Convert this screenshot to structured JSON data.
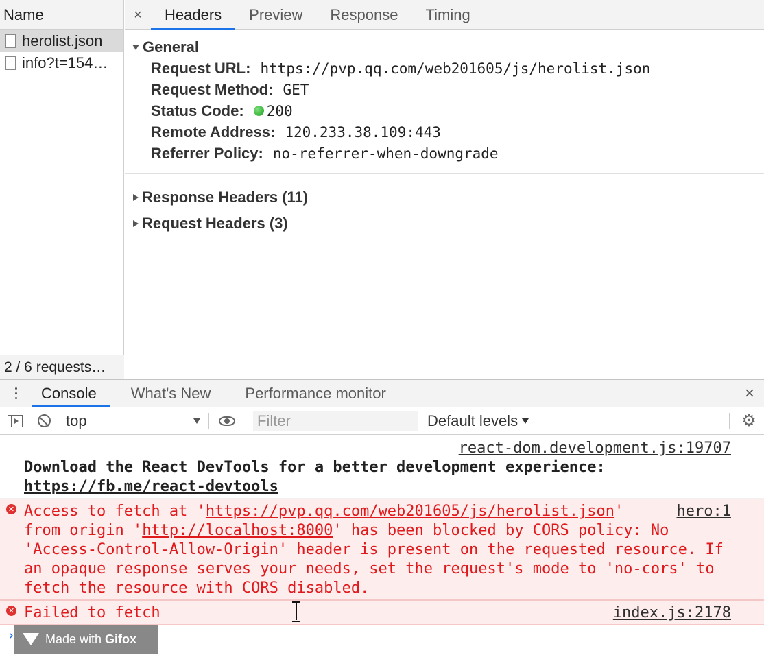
{
  "network": {
    "name_header": "Name",
    "requests": [
      {
        "label": "herolist.json",
        "selected": true
      },
      {
        "label": "info?t=154…",
        "selected": false
      }
    ],
    "summary": "2 / 6 requests…",
    "detail_tabs": [
      "Headers",
      "Preview",
      "Response",
      "Timing"
    ],
    "active_detail_tab": "Headers",
    "close_glyph": "×",
    "general": {
      "title": "General",
      "request_url_label": "Request URL:",
      "request_url": "https://pvp.qq.com/web201605/js/herolist.json",
      "request_method_label": "Request Method:",
      "request_method": "GET",
      "status_code_label": "Status Code:",
      "status_code": "200",
      "status_color": "#1a9e1a",
      "remote_address_label": "Remote Address:",
      "remote_address": "120.233.38.109:443",
      "referrer_policy_label": "Referrer Policy:",
      "referrer_policy": "no-referrer-when-downgrade"
    },
    "response_headers": "Response Headers (11)",
    "request_headers": "Request Headers (3)"
  },
  "drawer": {
    "tabs": [
      "Console",
      "What's New",
      "Performance monitor"
    ],
    "active_tab": "Console",
    "close_glyph": "×"
  },
  "console_toolbar": {
    "context": "top",
    "filter_placeholder": "Filter",
    "levels": "Default levels"
  },
  "console_messages": {
    "info": {
      "source": "react-dom.development.js:19707",
      "text": "Download the React DevTools for a better development experience: ",
      "link": "https://fb.me/react-devtools"
    },
    "cors_error": {
      "source": "hero:1",
      "part1": "Access to fetch at '",
      "url": "https://pvp.qq.com/web201605/js/herolist.json",
      "part2": "' from origin '",
      "origin": "http://localhost:8000",
      "part3": "' has been blocked by CORS policy: No 'Access-Control-Allow-Origin' header is present on the requested resource. If an opaque response serves your needs, set the request's mode to 'no-cors' to fetch the resource with CORS disabled."
    },
    "fetch_error": {
      "source": "index.js:2178",
      "text": "Failed to fetch"
    },
    "error_color": "#e0191c",
    "prompt": "›"
  },
  "watermark": {
    "prefix": "Made with ",
    "brand": "Gifox"
  }
}
